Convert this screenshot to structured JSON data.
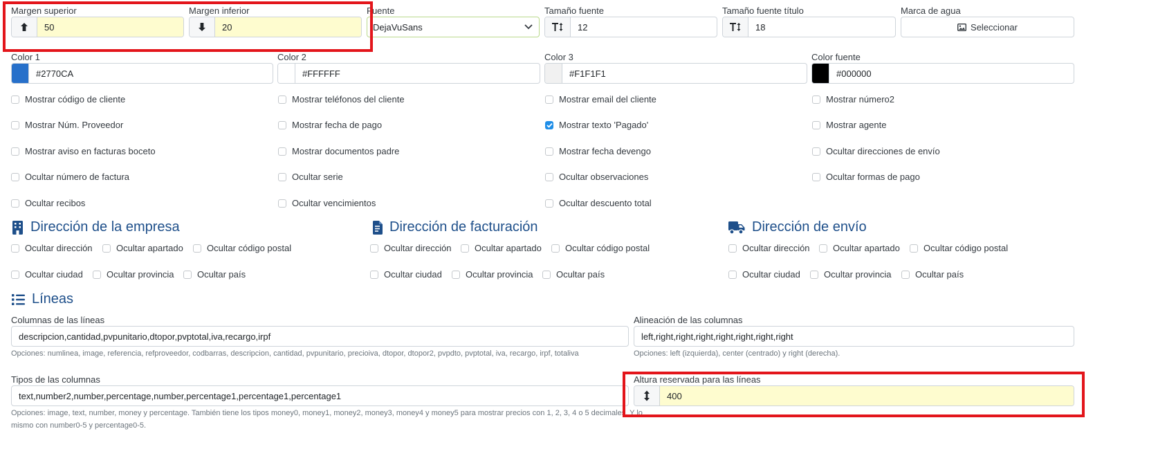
{
  "top_row": {
    "margin_top": {
      "label": "Margen superior",
      "value": "50",
      "icon": "arrow-up-icon"
    },
    "margin_bottom": {
      "label": "Margen inferior",
      "value": "20",
      "icon": "arrow-down-icon"
    },
    "font": {
      "label": "Fuente",
      "value": "DejaVuSans",
      "icon": "chevron-down-icon"
    },
    "font_size": {
      "label": "Tamaño fuente",
      "value": "12",
      "icon": "text-height-icon"
    },
    "title_font_size": {
      "label": "Tamaño fuente título",
      "value": "18",
      "icon": "text-height-icon"
    },
    "watermark": {
      "label": "Marca de agua",
      "button": "Seleccionar",
      "icon": "image-icon"
    }
  },
  "colors": [
    {
      "label": "Color 1",
      "value": "#2770CA",
      "swatch": "#2770CA"
    },
    {
      "label": "Color 2",
      "value": "#FFFFFF",
      "swatch": "#FFFFFF"
    },
    {
      "label": "Color 3",
      "value": "#F1F1F1",
      "swatch": "#F1F1F1"
    },
    {
      "label": "Color fuente",
      "value": "#000000",
      "swatch": "#000000"
    }
  ],
  "options": [
    [
      "Mostrar código de cliente",
      "Mostrar teléfonos del cliente",
      "Mostrar email del cliente",
      "Mostrar número2"
    ],
    [
      "Mostrar Núm. Proveedor",
      "Mostrar fecha de pago",
      "Mostrar texto 'Pagado'",
      "Mostrar agente"
    ],
    [
      "Mostrar aviso en facturas boceto",
      "Mostrar documentos padre",
      "Mostrar fecha devengo",
      "Ocultar direcciones de envío"
    ],
    [
      "Ocultar número de factura",
      "Ocultar serie",
      "Ocultar observaciones",
      "Ocultar formas de pago"
    ],
    [
      "Ocultar recibos",
      "Ocultar vencimientos",
      "Ocultar descuento total"
    ]
  ],
  "options_checked": "Mostrar texto 'Pagado'",
  "addresses": [
    {
      "title": "Dirección de la empresa",
      "icon": "building-icon",
      "row1": [
        "Ocultar dirección",
        "Ocultar apartado",
        "Ocultar código postal"
      ],
      "row2": [
        "Ocultar ciudad",
        "Ocultar provincia",
        "Ocultar país"
      ]
    },
    {
      "title": "Dirección de facturación",
      "icon": "invoice-icon",
      "row1": [
        "Ocultar dirección",
        "Ocultar apartado",
        "Ocultar código postal"
      ],
      "row2": [
        "Ocultar ciudad",
        "Ocultar provincia",
        "Ocultar país"
      ]
    },
    {
      "title": "Dirección de envío",
      "icon": "truck-icon",
      "row1": [
        "Ocultar dirección",
        "Ocultar apartado",
        "Ocultar código postal"
      ],
      "row2": [
        "Ocultar ciudad",
        "Ocultar provincia",
        "Ocultar país"
      ]
    }
  ],
  "lines": {
    "title": "Líneas",
    "columns": {
      "label": "Columnas de las líneas",
      "value": "descripcion,cantidad,pvpunitario,dtopor,pvptotal,iva,recargo,irpf",
      "help": "Opciones: numlinea, image, referencia, refproveedor, codbarras, descripcion, cantidad, pvpunitario, precioiva, dtopor, dtopor2, pvpdto, pvptotal, iva, recargo, irpf, totaliva"
    },
    "alignment": {
      "label": "Alineación de las columnas",
      "value": "left,right,right,right,right,right,right,right",
      "help": "Opciones: left (izquierda), center (centrado) y right (derecha)."
    },
    "types": {
      "label": "Tipos de las columnas",
      "value": "text,number2,number,percentage,number,percentage1,percentage1,percentage1",
      "help1": "Opciones: image, text, number, money y percentage. También tiene los tipos money0, money1, money2, money3, money4 y money5 para mostrar precios con 1, 2, 3, 4 o 5 decimales. Y lo",
      "help2": "mismo con number0-5 y percentage0-5."
    },
    "reserved_height": {
      "label": "Altura reservada para las líneas",
      "value": "400",
      "icon": "arrows-vertical-icon"
    }
  },
  "highlight_color": "#E3151B"
}
